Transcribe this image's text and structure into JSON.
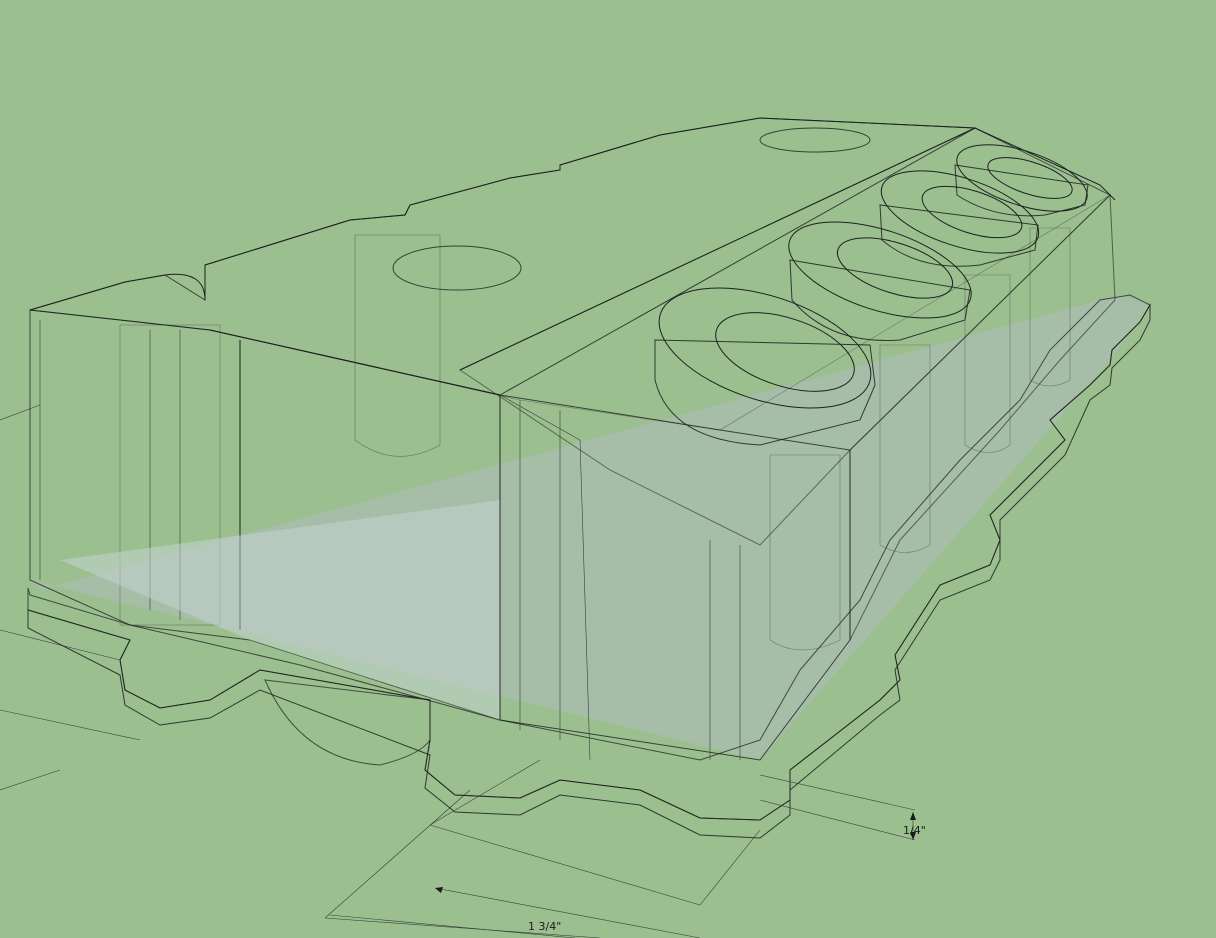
{
  "colors": {
    "ground": "#9bbf8e",
    "glass_light": "#c9d6d6",
    "glass_mid": "#b8c6c9",
    "glass_dark": "#9fa9b6",
    "edge": "#1d2020"
  },
  "dimensions": [
    {
      "label": "1/4\"",
      "name": "flange-thickness"
    },
    {
      "label": "1 3/4\"",
      "name": "port-spacing"
    }
  ]
}
